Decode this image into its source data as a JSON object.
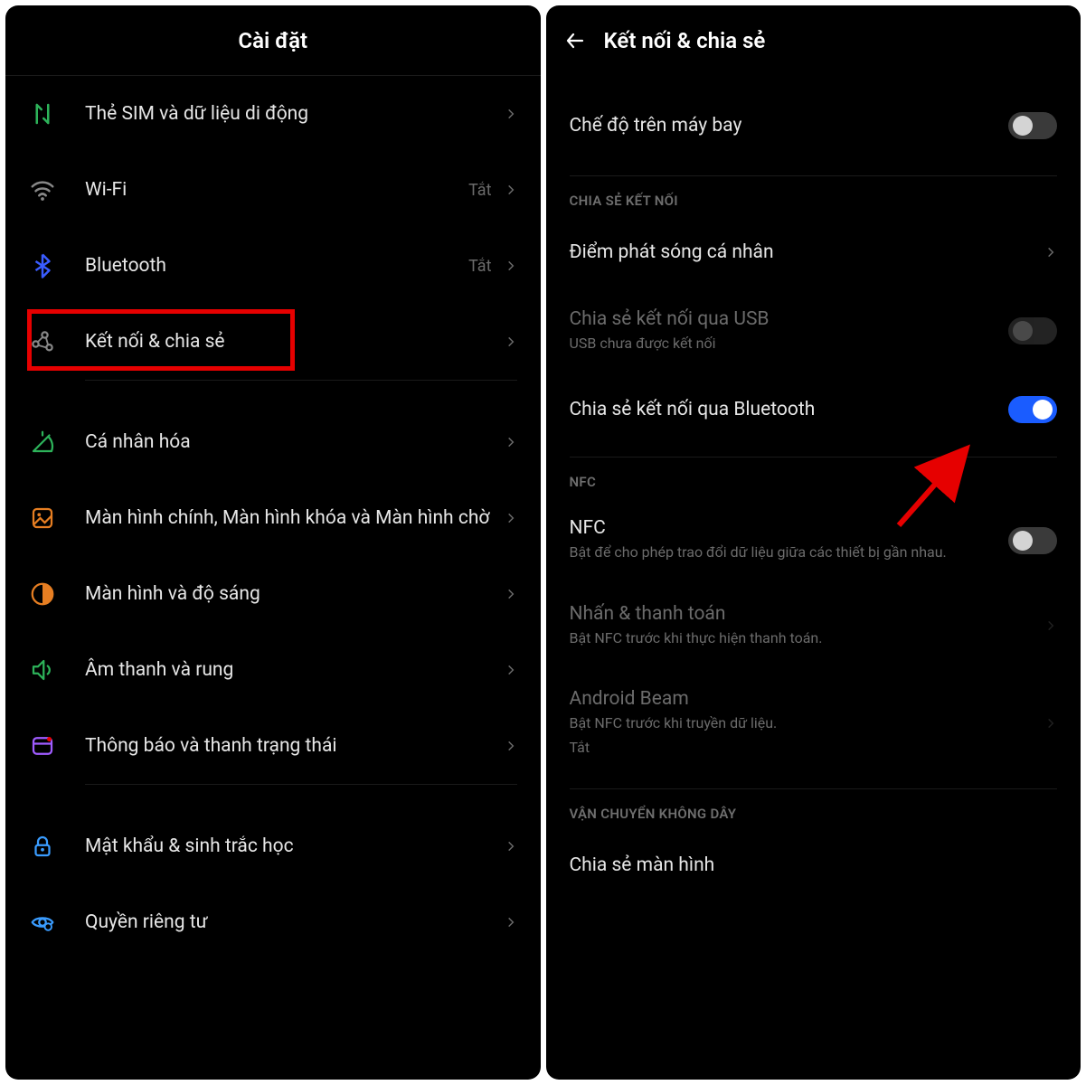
{
  "left": {
    "title": "Cài đặt",
    "items": [
      {
        "label": "Thẻ SIM và dữ liệu di động"
      },
      {
        "label": "Wi-Fi",
        "status": "Tắt"
      },
      {
        "label": "Bluetooth",
        "status": "Tắt"
      },
      {
        "label": "Kết nối & chia sẻ"
      },
      {
        "label": "Cá nhân hóa"
      },
      {
        "label": "Màn hình chính, Màn hình khóa và Màn hình chờ"
      },
      {
        "label": "Màn hình và độ sáng"
      },
      {
        "label": "Âm thanh và rung"
      },
      {
        "label": "Thông báo và thanh trạng thái"
      },
      {
        "label": "Mật khẩu & sinh trắc học"
      },
      {
        "label": "Quyền riêng tư"
      }
    ]
  },
  "right": {
    "title": "Kết nối & chia sẻ",
    "airplane": {
      "label": "Chế độ trên máy bay"
    },
    "section1": "CHIA SẺ KẾT NỐI",
    "hotspot": {
      "label": "Điểm phát sóng cá nhân"
    },
    "usb": {
      "label": "Chia sẻ kết nối qua USB",
      "sub": "USB chưa được kết nối"
    },
    "bt": {
      "label": "Chia sẻ kết nối qua Bluetooth"
    },
    "section2": "NFC",
    "nfc": {
      "label": "NFC",
      "sub": "Bật để cho phép trao đổi dữ liệu giữa các thiết bị gần nhau."
    },
    "pay": {
      "label": "Nhấn & thanh toán",
      "sub": "Bật NFC trước khi thực hiện thanh toán."
    },
    "beam": {
      "label": "Android Beam",
      "sub": "Bật NFC trước khi truyền dữ liệu.",
      "status": "Tắt"
    },
    "section3": "VẬN CHUYỂN KHÔNG DÂY",
    "cast": {
      "label": "Chia sẻ màn hình"
    }
  }
}
